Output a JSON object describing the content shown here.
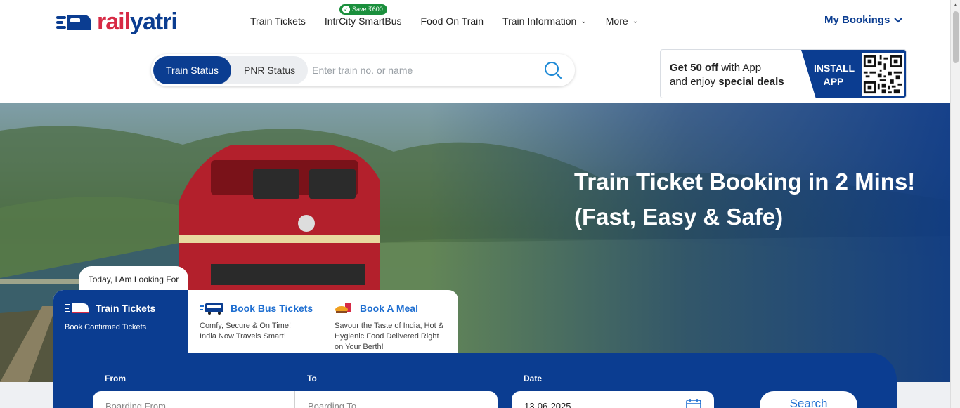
{
  "brand": {
    "logo_text_part1": "rail",
    "logo_text_part2": "yatri",
    "primary_color": "#0b3d91",
    "accent_color": "#d72a45"
  },
  "nav": {
    "items": [
      {
        "label": "Train Tickets"
      },
      {
        "label": "IntrCity SmartBus"
      },
      {
        "label": "Food On Train"
      },
      {
        "label": "Train Information"
      },
      {
        "label": "More"
      }
    ],
    "save_badge": "Save ₹600",
    "my_bookings": "My Bookings"
  },
  "search": {
    "tabs": [
      "Train Status",
      "PNR Status"
    ],
    "active_tab": "Train Status",
    "placeholder": "Enter train no. or name"
  },
  "promo": {
    "line1_bold": "Get 50 off",
    "line1_rest": " with App",
    "line2_rest": "and enjoy ",
    "line2_bold": "special deals",
    "install_line1": "INSTALL",
    "install_line2": "APP"
  },
  "hero": {
    "title_line1": "Train Ticket Booking in 2 Mins!",
    "title_line2": "(Fast, Easy & Safe)"
  },
  "booking": {
    "looking_for": "Today, I Am Looking For",
    "tabs": [
      {
        "title": "Train Tickets",
        "desc": "Book Confirmed Tickets",
        "icon": "train-icon"
      },
      {
        "title": "Book Bus Tickets",
        "desc1": "Comfy, Secure & On Time!",
        "desc2": "India Now Travels Smart!",
        "icon": "bus-icon"
      },
      {
        "title": "Book A Meal",
        "desc1": "Savour the Taste of India, Hot &",
        "desc2": "Hygienic Food Delivered Right",
        "desc3": "on Your Berth!",
        "icon": "meal-icon"
      }
    ],
    "from_label": "From",
    "from_placeholder": "Boarding From",
    "to_label": "To",
    "to_placeholder": "Boarding To",
    "date_label": "Date",
    "date_value": "13-06-2025",
    "search_label": "Search"
  }
}
